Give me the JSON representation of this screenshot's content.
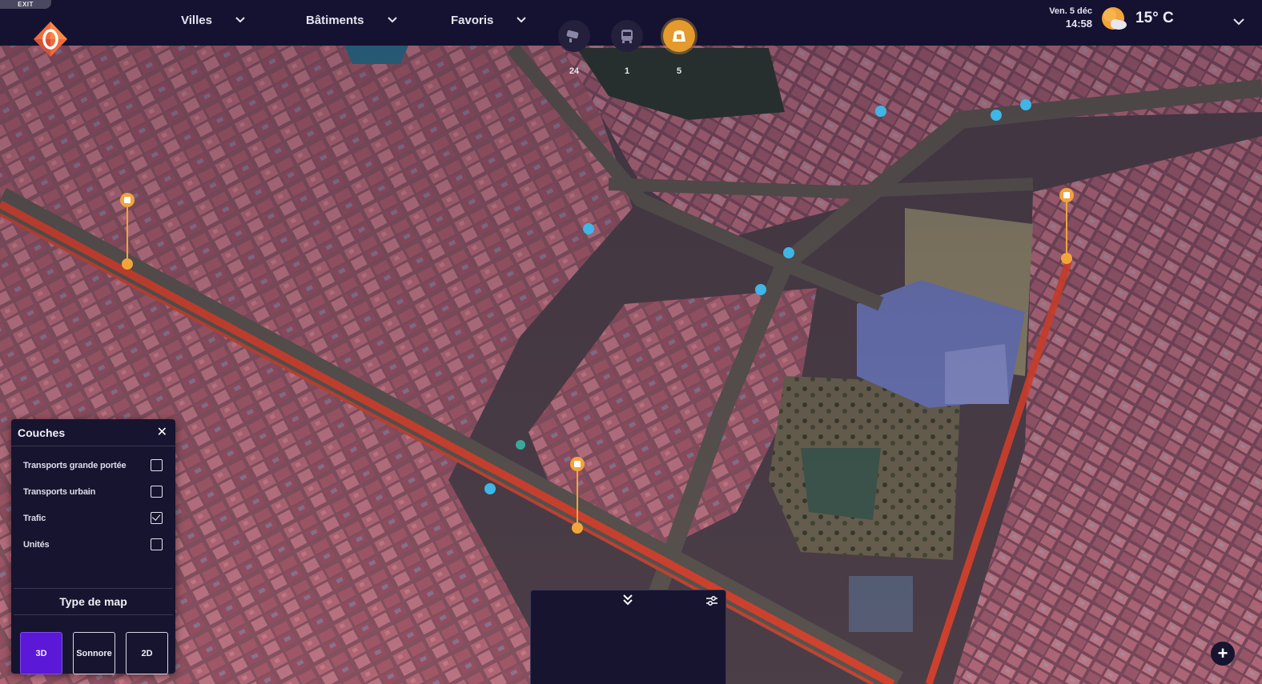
{
  "topbar": {
    "exit_label": "EXIT",
    "menus": [
      {
        "label": "Villes"
      },
      {
        "label": "Bâtiments"
      },
      {
        "label": "Favoris"
      }
    ],
    "date": "Ven. 5 déc",
    "time": "14:58",
    "temperature": "15° C",
    "weather_icon": "partly-cloudy-icon"
  },
  "layers_panel": {
    "title": "Couches",
    "items": [
      {
        "label": "Transports grande portée",
        "checked": false
      },
      {
        "label": "Transports urbain",
        "checked": false
      },
      {
        "label": "Trafic",
        "checked": true
      },
      {
        "label": "Unités",
        "checked": false
      }
    ],
    "map_type_title": "Type de map",
    "map_types": [
      {
        "label": "3D",
        "active": true
      },
      {
        "label": "Sonnore",
        "active": false
      },
      {
        "label": "2D",
        "active": false
      }
    ]
  },
  "counter_panel": {
    "items": [
      {
        "icon": "camera-icon",
        "count": "24",
        "active": false
      },
      {
        "icon": "bus-icon",
        "count": "1",
        "active": false
      },
      {
        "icon": "parking-icon",
        "count": "5",
        "active": true
      }
    ]
  },
  "map": {
    "traffic_color": "#e8442a",
    "marker_blue": "#3fb6e6",
    "marker_orange": "#f2a43a"
  },
  "colors": {
    "panel_bg": "#17142f",
    "topbar_bg": "#141230",
    "accent_purple": "#5b18d6",
    "accent_orange": "#e59a2c"
  }
}
